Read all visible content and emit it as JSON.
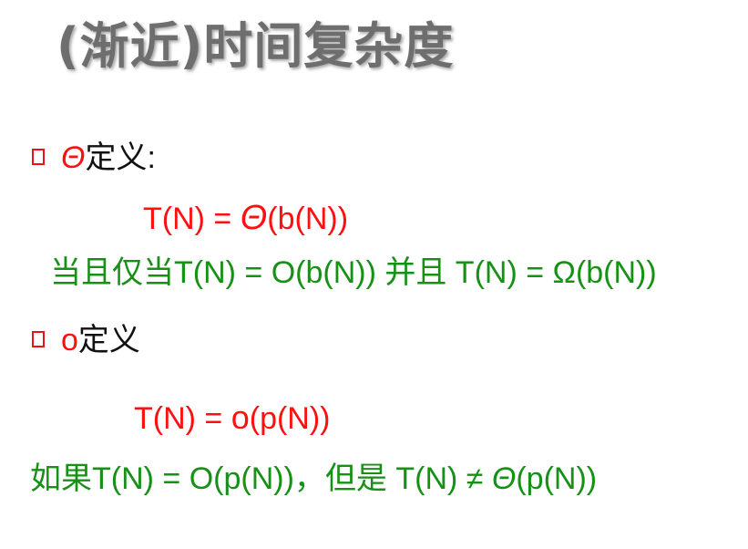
{
  "slide": {
    "title": "(渐近)时间复杂度",
    "theta_section": {
      "symbol": "Θ",
      "label": "定义",
      "colon": ":",
      "formula_prefix": "T(N) = ",
      "formula_symbol": "Θ",
      "formula_suffix": "(b(N))",
      "condition_cjk_1": "当且仅当",
      "condition_part_1": "T(N) = O(b(N)) ",
      "condition_cjk_2": "并且",
      "condition_part_2": " T(N) = Ω(b(N))"
    },
    "o_section": {
      "symbol": "o",
      "label": "定义",
      "formula_prefix": "T(N) = ",
      "formula_symbol": "o",
      "formula_suffix": "(p(N))",
      "condition_cjk_1": "如果",
      "condition_part_1": "T(N) = O(p(N))",
      "condition_cjk_2": "，但是",
      "condition_part_2": " T(N) ≠ ",
      "condition_symbol": "Θ",
      "condition_part_3": "(p(N))"
    }
  },
  "colors": {
    "title": "#6e6e6e",
    "red": "#ff1010",
    "green": "#169116",
    "bullet": "#e8141a"
  }
}
